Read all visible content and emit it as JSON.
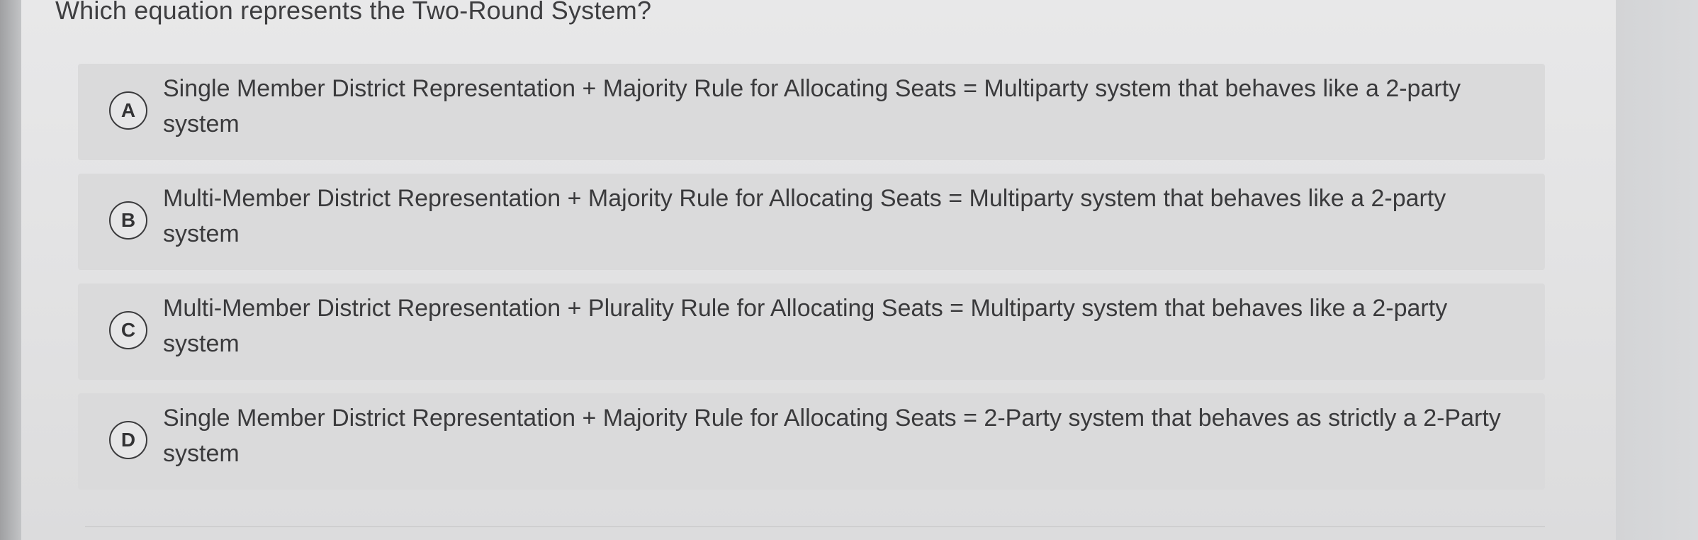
{
  "question": "Which equation represents the Two-Round System?",
  "options": [
    {
      "letter": "A",
      "text": "Single Member District Representation + Majority Rule for Allocating Seats = Multiparty system that behaves like a 2-party system"
    },
    {
      "letter": "B",
      "text": "Multi-Member District Representation + Majority Rule for Allocating Seats = Multiparty system that behaves like a 2-party system"
    },
    {
      "letter": "C",
      "text": "Multi-Member District Representation + Plurality Rule for Allocating Seats = Multiparty system that behaves like a 2-party system"
    },
    {
      "letter": "D",
      "text": "Single Member District Representation + Majority Rule for Allocating Seats = 2-Party system that behaves as strictly a 2-Party system"
    }
  ]
}
